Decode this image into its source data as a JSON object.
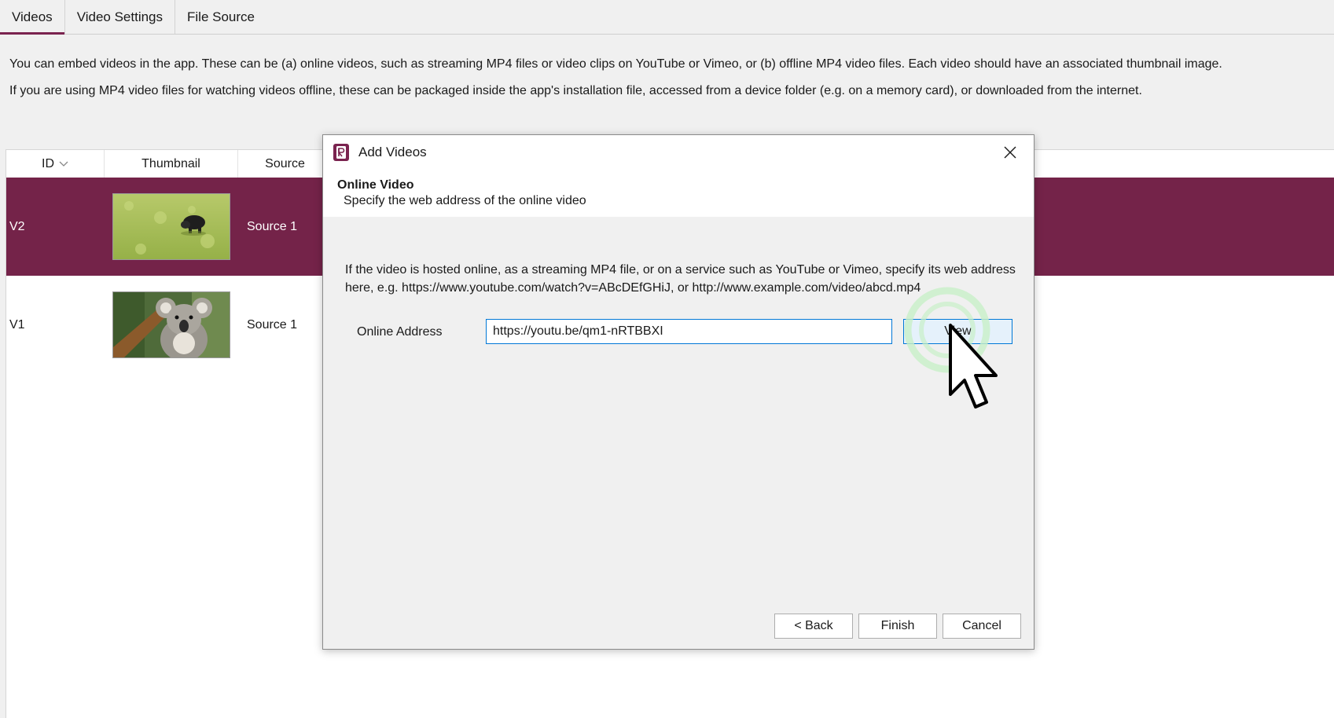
{
  "tabs": [
    {
      "label": "Videos",
      "active": true
    },
    {
      "label": "Video Settings",
      "active": false
    },
    {
      "label": "File Source",
      "active": false
    }
  ],
  "intro": {
    "line1": "You can embed videos in the app. These can be (a) online videos, such as streaming MP4 files or video clips on YouTube or Vimeo, or (b) offline MP4 video files. Each video should have an associated thumbnail image.",
    "line2": "If you are using MP4 video files for watching videos offline, these can be packaged inside the app's installation file, accessed from a device folder (e.g. on a memory card), or downloaded from the internet."
  },
  "table": {
    "headers": {
      "id": "ID",
      "thumbnail": "Thumbnail",
      "source": "Source"
    },
    "rows": [
      {
        "id": "V2",
        "source": "Source 1",
        "selected": true,
        "thumbnail_icon": "thumbnail-grass-animal"
      },
      {
        "id": "V1",
        "source": "Source 1",
        "selected": false,
        "thumbnail_icon": "thumbnail-koala"
      }
    ]
  },
  "dialog": {
    "title": "Add Videos",
    "header_title": "Online Video",
    "header_subtitle": "Specify the web address of the online video",
    "description": "If the video is hosted online, as a streaming MP4 file, or on a service such as YouTube or Vimeo, specify its web address here, e.g. https://www.youtube.com/watch?v=ABcDEfGHiJ, or http://www.example.com/video/abcd.mp4",
    "address_label": "Online Address",
    "address_value": "https://youtu.be/qm1-nRTBBXI",
    "view_label": "View",
    "back_label": "< Back",
    "finish_label": "Finish",
    "cancel_label": "Cancel"
  },
  "colors": {
    "accent": "#742349",
    "focus": "#0078d7",
    "click_ring": "#c8f0c8"
  }
}
